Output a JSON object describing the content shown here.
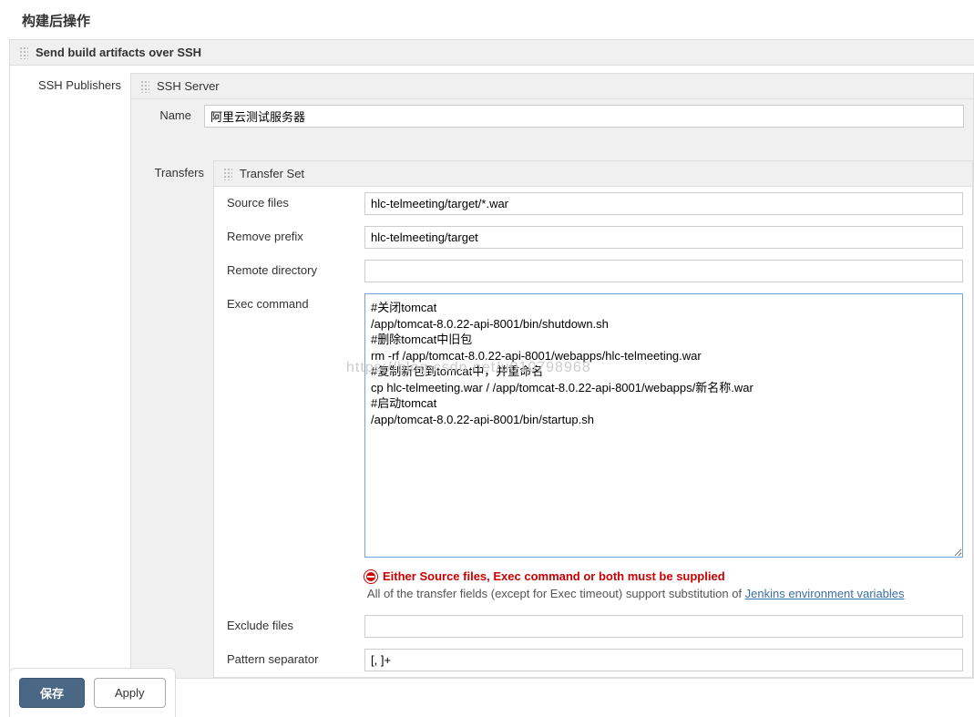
{
  "section_title": "构建后操作",
  "group_title": "Send build artifacts over SSH",
  "ssh_publishers_label": "SSH Publishers",
  "ssh_server": {
    "title": "SSH Server",
    "name_label": "Name",
    "name_value": "阿里云测试服务器"
  },
  "transfers_label": "Transfers",
  "transfer_set": {
    "title": "Transfer Set",
    "source_files_label": "Source files",
    "source_files_value": "hlc-telmeeting/target/*.war",
    "remove_prefix_label": "Remove prefix",
    "remove_prefix_value": "hlc-telmeeting/target",
    "remote_directory_label": "Remote directory",
    "remote_directory_value": "",
    "exec_command_label": "Exec command",
    "exec_command_value": "#关闭tomcat\n/app/tomcat-8.0.22-api-8001/bin/shutdown.sh\n#删除tomcat中旧包\nrm -rf /app/tomcat-8.0.22-api-8001/webapps/hlc-telmeeting.war\n#复制新包到tomcat中，并重命名\ncp hlc-telmeeting.war / /app/tomcat-8.0.22-api-8001/webapps/新名称.war\n#启动tomcat\n/app/tomcat-8.0.22-api-8001/bin/startup.sh",
    "error_message": "Either Source files, Exec command or both must be supplied",
    "help_text_prefix": "All of the transfer fields (except for Exec timeout) support substitution of ",
    "help_link_text": "Jenkins environment variables",
    "exclude_files_label": "Exclude files",
    "exclude_files_value": "",
    "pattern_separator_label": "Pattern separator",
    "pattern_separator_value": "[, ]+"
  },
  "buttons": {
    "save": "保存",
    "apply": "Apply"
  },
  "watermark": "https://blog.csdn.net/u010798968"
}
